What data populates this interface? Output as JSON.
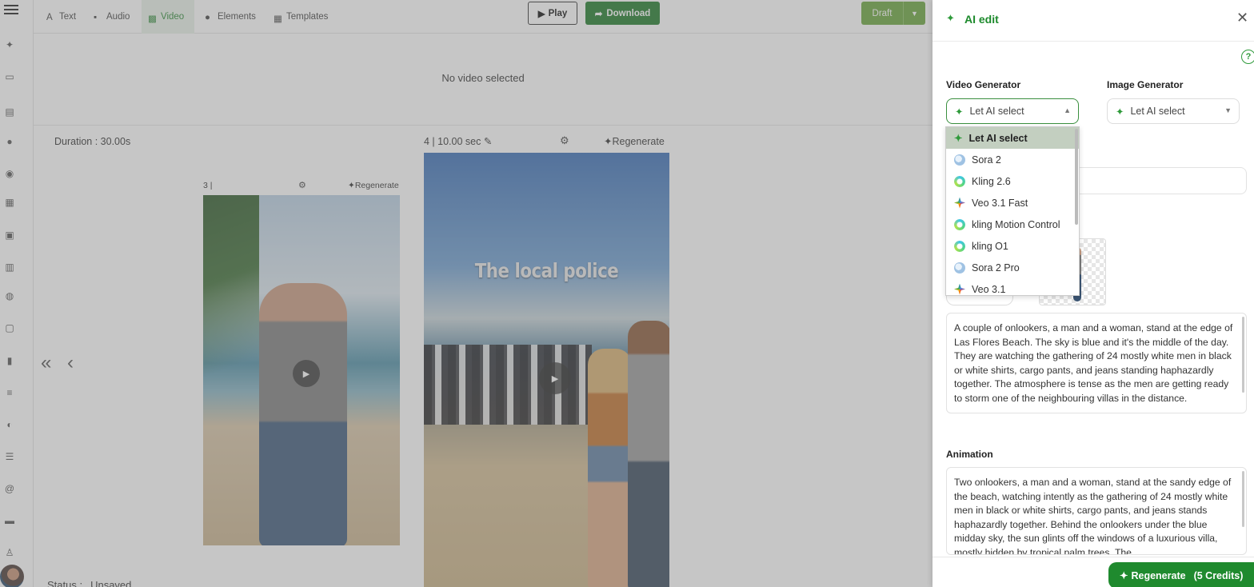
{
  "topbar": {
    "tabs": [
      {
        "label": "Text",
        "icon": "text-icon"
      },
      {
        "label": "Audio",
        "icon": "audio-icon"
      },
      {
        "label": "Video",
        "icon": "video-icon",
        "active": true
      },
      {
        "label": "Elements",
        "icon": "elements-icon"
      },
      {
        "label": "Templates",
        "icon": "templates-icon"
      }
    ],
    "play_label": "Play",
    "download_label": "Download",
    "draft_label": "Draft"
  },
  "preview": {
    "empty_text": "No video selected"
  },
  "workspace": {
    "duration": "Duration : 30.00s",
    "status_label": "Status :",
    "status_value": "Unsaved",
    "scene3": {
      "header": "3 |",
      "regenerate": "Regenerate"
    },
    "scene4": {
      "header": "4 |  10.00 sec",
      "regenerate": "Regenerate",
      "caption": "The local police"
    }
  },
  "panel": {
    "title": "AI edit",
    "video_generator": {
      "label": "Video Generator",
      "selected": "Let AI select",
      "options": [
        {
          "label": "Let AI select",
          "icon": "sparkle"
        },
        {
          "label": "Sora 2",
          "icon": "sora"
        },
        {
          "label": "Kling 2.6",
          "icon": "kling"
        },
        {
          "label": "Veo 3.1 Fast",
          "icon": "veo"
        },
        {
          "label": "kling Motion Control",
          "icon": "kling"
        },
        {
          "label": "kling O1",
          "icon": "kling"
        },
        {
          "label": "Sora 2 Pro",
          "icon": "sora"
        },
        {
          "label": "Veo 3.1",
          "icon": "veo"
        }
      ]
    },
    "image_generator": {
      "label": "Image Generator",
      "selected": "Let AI select"
    },
    "image_prompt": "A couple of onlookers, a man and a woman, stand at the edge of Las Flores Beach. The sky is blue and it's the middle of the day. They are watching the gathering of 24 mostly white men in black or white shirts, cargo pants, and jeans standing haphazardly together. The atmosphere is tense as the men are getting ready to storm one of the neighbouring villas in the distance.",
    "animation_label": "Animation",
    "animation_prompt": "Two onlookers, a man and a woman, stand at the sandy edge of the beach, watching intently as the gathering of 24 mostly white men in black or white shirts, cargo pants, and jeans stands haphazardly together. Behind the onlookers under the blue midday sky, the sun glints off the windows of a luxurious villa, mostly hidden by tropical palm trees. The",
    "regenerate_label": "Regenerate",
    "regenerate_credits": "(5 Credits)"
  },
  "colors": {
    "brand_green": "#1f8a2e",
    "draft_green": "#6aa63d",
    "selected_option_bg": "#c3cfc0"
  }
}
